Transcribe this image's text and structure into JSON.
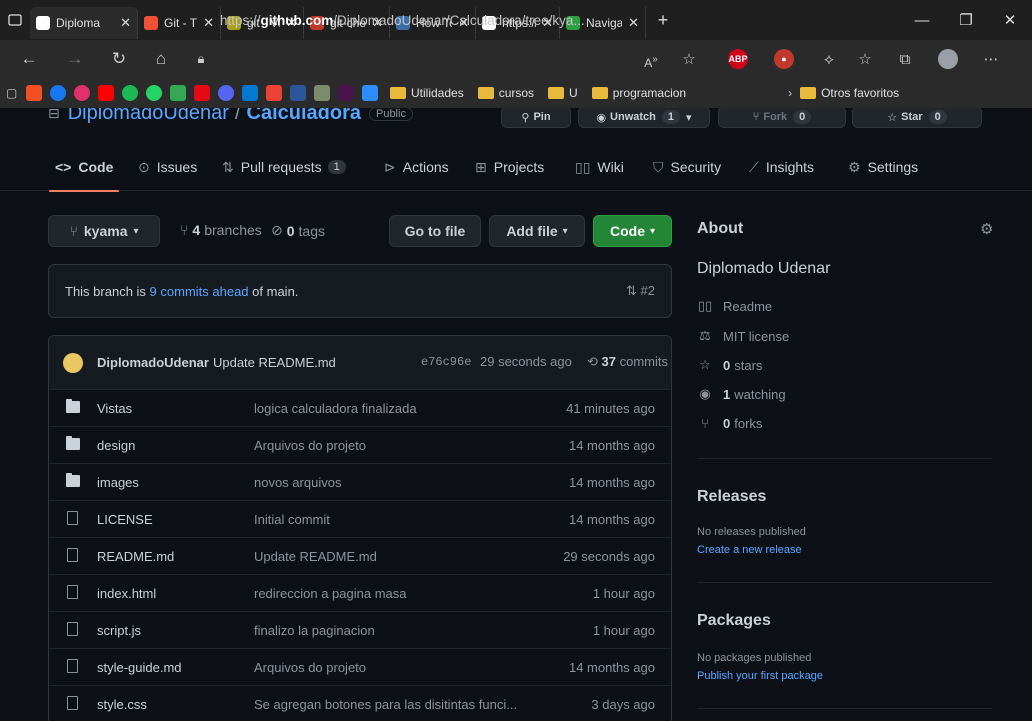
{
  "browser": {
    "tabs": [
      {
        "label": "Diploma",
        "color": "#ffffff",
        "active": true
      },
      {
        "label": "Git - Tra",
        "color": "#f05033"
      },
      {
        "label": "git - Vol",
        "color": "#a8a020"
      },
      {
        "label": "git-chea",
        "color": "#c0392b"
      },
      {
        "label": "How To",
        "color": "#3a6ea5"
      },
      {
        "label": "https://",
        "color": "#ffffff"
      },
      {
        "label": "Navigat",
        "color": "#2ea043"
      }
    ],
    "url_prefix": "https://",
    "url_domain": "github.com",
    "url_path": "/DiplomadoUdenar/Calculadora/tree/kya...",
    "bookmarks": {
      "folder1": "Utilidades",
      "folder2": "cursos",
      "folder3": "U",
      "folder4": "programacion",
      "overflow": "Otros favoritos"
    }
  },
  "repo": {
    "owner": "DiplomadoUdenar",
    "name": "Calculadora",
    "visibility": "Public",
    "pin": "Pin",
    "unwatch": "Unwatch",
    "unwatch_count": "1",
    "fork": "Fork",
    "fork_count": "0",
    "star": "Star",
    "star_count": "0"
  },
  "nav": {
    "code": "Code",
    "issues": "Issues",
    "pulls": "Pull requests",
    "pulls_count": "1",
    "actions": "Actions",
    "projects": "Projects",
    "wiki": "Wiki",
    "security": "Security",
    "insights": "Insights",
    "settings": "Settings"
  },
  "toolbar": {
    "branch": "kyama",
    "branches_count": "4",
    "branches_label": "branches",
    "tags_count": "0",
    "tags_label": "tags",
    "goto": "Go to file",
    "addfile": "Add file",
    "code": "Code"
  },
  "banner": {
    "prefix": "This branch is",
    "link": "9 commits ahead",
    "suffix": "of main.",
    "pr": "#2"
  },
  "commit": {
    "author": "DiplomadoUdenar",
    "message": "Update README.md",
    "sha": "e76c96e",
    "ago": "29 seconds ago",
    "count": "37",
    "count_label": "commits"
  },
  "files": [
    {
      "name": "Vistas",
      "type": "dir",
      "message": "logica calculadora finalizada",
      "age": "41 minutes ago"
    },
    {
      "name": "design",
      "type": "dir",
      "message": "Arquivos do projeto",
      "age": "14 months ago"
    },
    {
      "name": "images",
      "type": "dir",
      "message": "novos arquivos",
      "age": "14 months ago"
    },
    {
      "name": "LICENSE",
      "type": "file",
      "message": "Initial commit",
      "age": "14 months ago"
    },
    {
      "name": "README.md",
      "type": "file",
      "message": "Update README.md",
      "age": "29 seconds ago"
    },
    {
      "name": "index.html",
      "type": "file",
      "message": "redireccion a pagina masa",
      "age": "1 hour ago"
    },
    {
      "name": "script.js",
      "type": "file",
      "message": "finalizo la paginacion",
      "age": "1 hour ago"
    },
    {
      "name": "style-guide.md",
      "type": "file",
      "message": "Arquivos do projeto",
      "age": "14 months ago"
    },
    {
      "name": "style.css",
      "type": "file",
      "message": "Se agregan botones para las disitintas funci...",
      "age": "3 days ago"
    }
  ],
  "about": {
    "title": "About",
    "description": "Diplomado Udenar",
    "readme": "Readme",
    "license": "MIT license",
    "stars_count": "0",
    "stars_label": "stars",
    "watching_count": "1",
    "watching_label": "watching",
    "forks_count": "0",
    "forks_label": "forks"
  },
  "releases": {
    "title": "Releases",
    "empty": "No releases published",
    "link": "Create a new release"
  },
  "packages": {
    "title": "Packages",
    "empty": "No packages published",
    "link": "Publish your first package"
  }
}
